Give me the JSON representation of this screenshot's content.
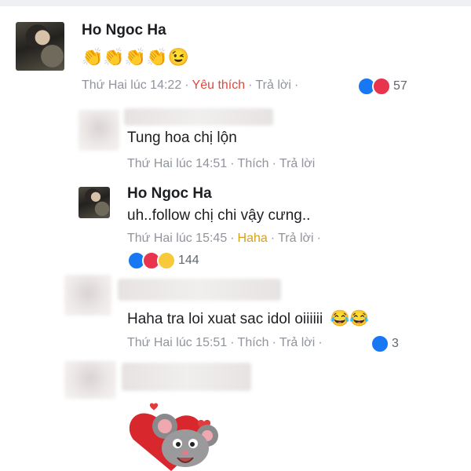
{
  "comments": [
    {
      "author": "Ho Ngoc Ha",
      "text": "👏👏👏👏😉",
      "time": "Thứ Hai lúc 14:22",
      "action_reaction": "Yêu thích",
      "action_reply": "Trả lời",
      "reaction_count": "57"
    },
    {
      "author": "",
      "text": "Tung hoa chị lộn",
      "time": "Thứ Hai lúc 14:51",
      "action_reaction": "Thích",
      "action_reply": "Trả lời"
    },
    {
      "author": "Ho Ngoc Ha",
      "text": "uh..follow chị chi vậy cưng..",
      "time": "Thứ Hai lúc 15:45",
      "action_reaction": "Haha",
      "action_reply": "Trả lời",
      "reaction_count": "144"
    },
    {
      "author": "",
      "text": "Haha tra loi xuat sac idol oiiiiii",
      "emoji": "😂😂",
      "time": "Thứ Hai lúc 15:51",
      "action_reaction": "Thích",
      "action_reply": "Trả lời",
      "reaction_count": "3"
    },
    {
      "author": "",
      "sticker": "mouse-heart-sticker"
    }
  ],
  "separator": "·",
  "colors": {
    "liked": "#d94a3f",
    "haha": "#d7a11a",
    "meta": "#90949c",
    "like_blue": "#1877f2",
    "love_red": "#e8354d"
  }
}
